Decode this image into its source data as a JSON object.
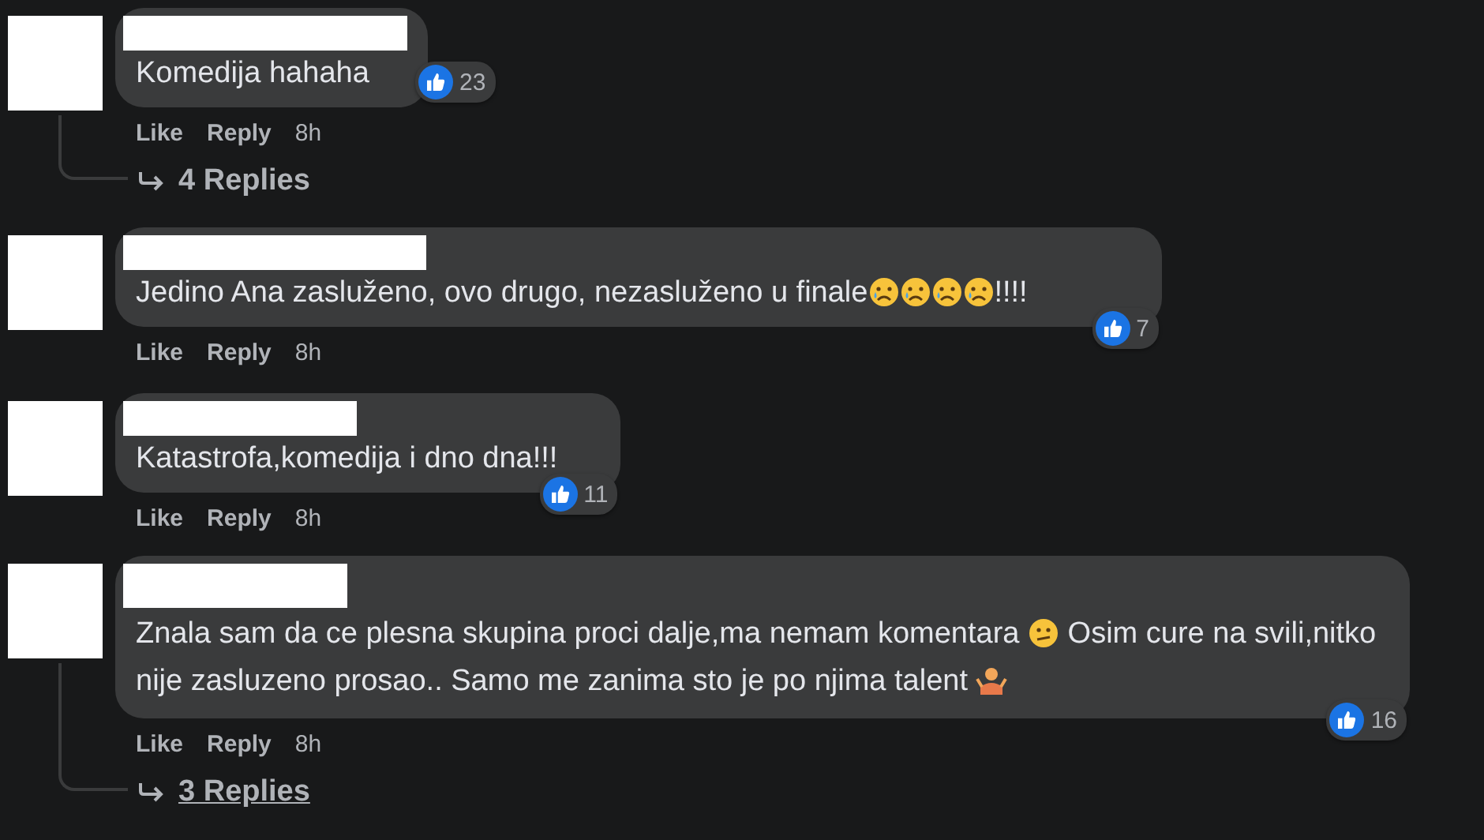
{
  "comments": [
    {
      "body": [
        {
          "kind": "text",
          "text": "Komedija hahaha"
        }
      ],
      "reaction_count": "23",
      "actions": [
        "Like",
        "Reply"
      ],
      "time": "8h",
      "replies": {
        "label": "4 Replies",
        "underlined": false
      }
    },
    {
      "body": [
        {
          "kind": "text",
          "text": "Jedino Ana zasluženo, ovo drugo, nezasluženo u finale"
        },
        {
          "kind": "sad-face"
        },
        {
          "kind": "sad-face"
        },
        {
          "kind": "sad-face"
        },
        {
          "kind": "sad-face"
        },
        {
          "kind": "text",
          "text": "!!!!"
        }
      ],
      "reaction_count": "7",
      "actions": [
        "Like",
        "Reply"
      ],
      "time": "8h"
    },
    {
      "body": [
        {
          "kind": "text",
          "text": "Katastrofa,komedija i dno dna!!!"
        }
      ],
      "reaction_count": "11",
      "actions": [
        "Like",
        "Reply"
      ],
      "time": "8h"
    },
    {
      "body": [
        {
          "kind": "text",
          "text": "Znala sam da ce plesna skupina proci dalje,ma nemam komentara "
        },
        {
          "kind": "confused-face"
        },
        {
          "kind": "text",
          "text": " Osim cure na svili,nitko nije zasluzeno prosao.. Samo me zanima sto je po njima talent "
        },
        {
          "kind": "shrug"
        }
      ],
      "reaction_count": "16",
      "actions": [
        "Like",
        "Reply"
      ],
      "time": "8h",
      "replies": {
        "label": "3 Replies",
        "underlined": true
      }
    }
  ]
}
